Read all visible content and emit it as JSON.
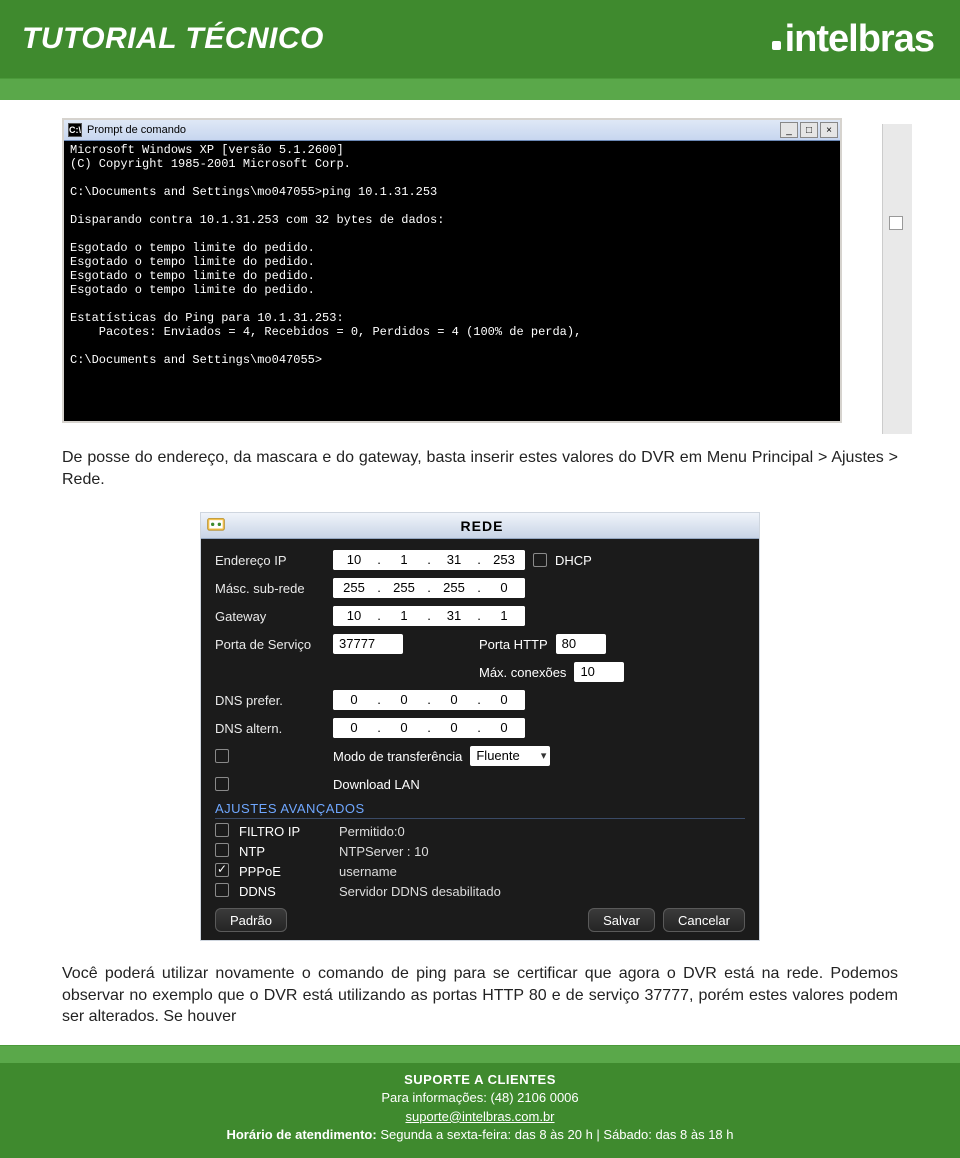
{
  "header": {
    "title": "TUTORIAL TÉCNICO",
    "brand": "intelbras"
  },
  "cmd": {
    "window_title": "Prompt de comando",
    "lines": [
      "Microsoft Windows XP [versão 5.1.2600]",
      "(C) Copyright 1985-2001 Microsoft Corp.",
      "",
      "C:\\Documents and Settings\\mo047055>ping 10.1.31.253",
      "",
      "Disparando contra 10.1.31.253 com 32 bytes de dados:",
      "",
      "Esgotado o tempo limite do pedido.",
      "Esgotado o tempo limite do pedido.",
      "Esgotado o tempo limite do pedido.",
      "Esgotado o tempo limite do pedido.",
      "",
      "Estatísticas do Ping para 10.1.31.253:",
      "    Pacotes: Enviados = 4, Recebidos = 0, Perdidos = 4 (100% de perda),",
      "",
      "C:\\Documents and Settings\\mo047055>"
    ]
  },
  "p1": "De posse do endereço, da mascara e do gateway, basta inserir estes valores do DVR em Menu Principal > Ajustes > Rede.",
  "rede": {
    "title": "REDE",
    "labels": {
      "ip": "Endereço IP",
      "mask": "Másc. sub-rede",
      "gateway": "Gateway",
      "svc_port": "Porta de Serviço",
      "http_port": "Porta HTTP",
      "max_conn": "Máx. conexões",
      "dns1": "DNS prefer.",
      "dns2": "DNS altern.",
      "mode": "Modo de transferência",
      "dl_lan": "Download LAN",
      "dhcp": "DHCP",
      "adv": "AJUSTES AVANÇADOS"
    },
    "ip": [
      "10",
      "1",
      "31",
      "253"
    ],
    "mask": [
      "255",
      "255",
      "255",
      "0"
    ],
    "gateway": [
      "10",
      "1",
      "31",
      "1"
    ],
    "svc_port": "37777",
    "http_port": "80",
    "max_conn": "10",
    "dns1": [
      "0",
      "0",
      "0",
      "0"
    ],
    "dns2": [
      "0",
      "0",
      "0",
      "0"
    ],
    "mode_value": "Fluente",
    "adv_items": [
      {
        "checked": false,
        "name": "FILTRO IP",
        "status": "Permitido:0"
      },
      {
        "checked": false,
        "name": "NTP",
        "status": "NTPServer : 10"
      },
      {
        "checked": true,
        "name": "PPPoE",
        "status": "username"
      },
      {
        "checked": false,
        "name": "DDNS",
        "status": "Servidor DDNS desabilitado"
      }
    ],
    "buttons": {
      "default": "Padrão",
      "save": "Salvar",
      "cancel": "Cancelar"
    }
  },
  "p2": "Você poderá utilizar novamente o comando de ping para se certificar que agora o DVR está na rede. Podemos observar no exemplo que o DVR está utilizando as portas HTTP 80 e de serviço 37777, porém estes valores podem ser alterados. Se houver",
  "footer": {
    "l1": "SUPORTE A CLIENTES",
    "l2a": "Para informações: ",
    "l2b": "(48) 2106 0006",
    "l3": "suporte@intelbras.com.br",
    "l4a": "Horário de atendimento: ",
    "l4b": "Segunda a sexta-feira: das 8 às 20 h | Sábado: das 8 às 18 h"
  }
}
